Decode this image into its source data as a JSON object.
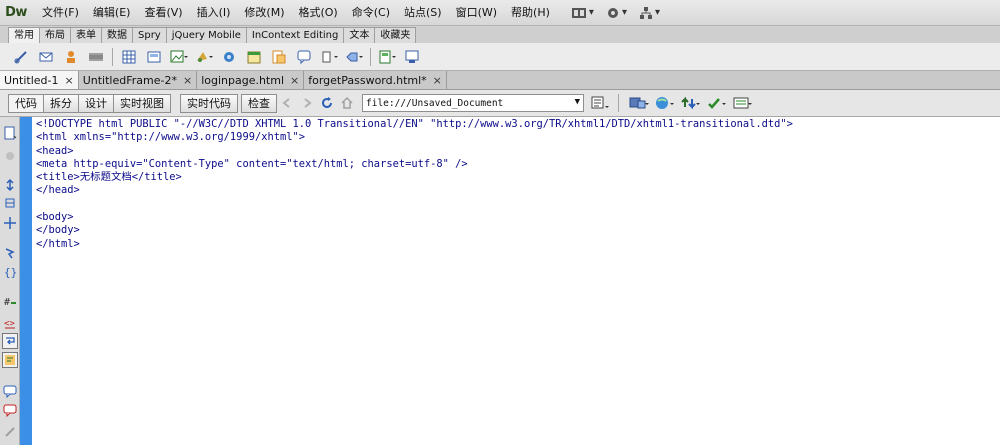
{
  "app": {
    "logo": "Dw"
  },
  "menu": [
    "文件(F)",
    "编辑(E)",
    "查看(V)",
    "插入(I)",
    "修改(M)",
    "格式(O)",
    "命令(C)",
    "站点(S)",
    "窗口(W)",
    "帮助(H)"
  ],
  "insert_tabs": [
    {
      "label": "常用",
      "active": true
    },
    {
      "label": "布局"
    },
    {
      "label": "表单"
    },
    {
      "label": "数据"
    },
    {
      "label": "Spry"
    },
    {
      "label": "jQuery Mobile"
    },
    {
      "label": "InContext Editing"
    },
    {
      "label": "文本"
    },
    {
      "label": "收藏夹"
    }
  ],
  "doc_tabs": [
    {
      "label": "Untitled-1",
      "active": true
    },
    {
      "label": "UntitledFrame-2*"
    },
    {
      "label": "loginpage.html"
    },
    {
      "label": "forgetPassword.html*"
    }
  ],
  "close_glyph": "×",
  "view_buttons": {
    "code": "代码",
    "split": "拆分",
    "design": "设计",
    "live_view": "实时视图",
    "live_code": "实时代码",
    "inspect": "检查"
  },
  "address": {
    "value": "file:///Unsaved_Document"
  },
  "code_lines": [
    "<!DOCTYPE html PUBLIC \"-//W3C//DTD XHTML 1.0 Transitional//EN\" \"http://www.w3.org/TR/xhtml1/DTD/xhtml1-transitional.dtd\">",
    "<html xmlns=\"http://www.w3.org/1999/xhtml\">",
    "<head>",
    "<meta http-equiv=\"Content-Type\" content=\"text/html; charset=utf-8\" />",
    "<title>无标题文档</title>",
    "</head>",
    "",
    "<body>",
    "</body>",
    "</html>"
  ]
}
